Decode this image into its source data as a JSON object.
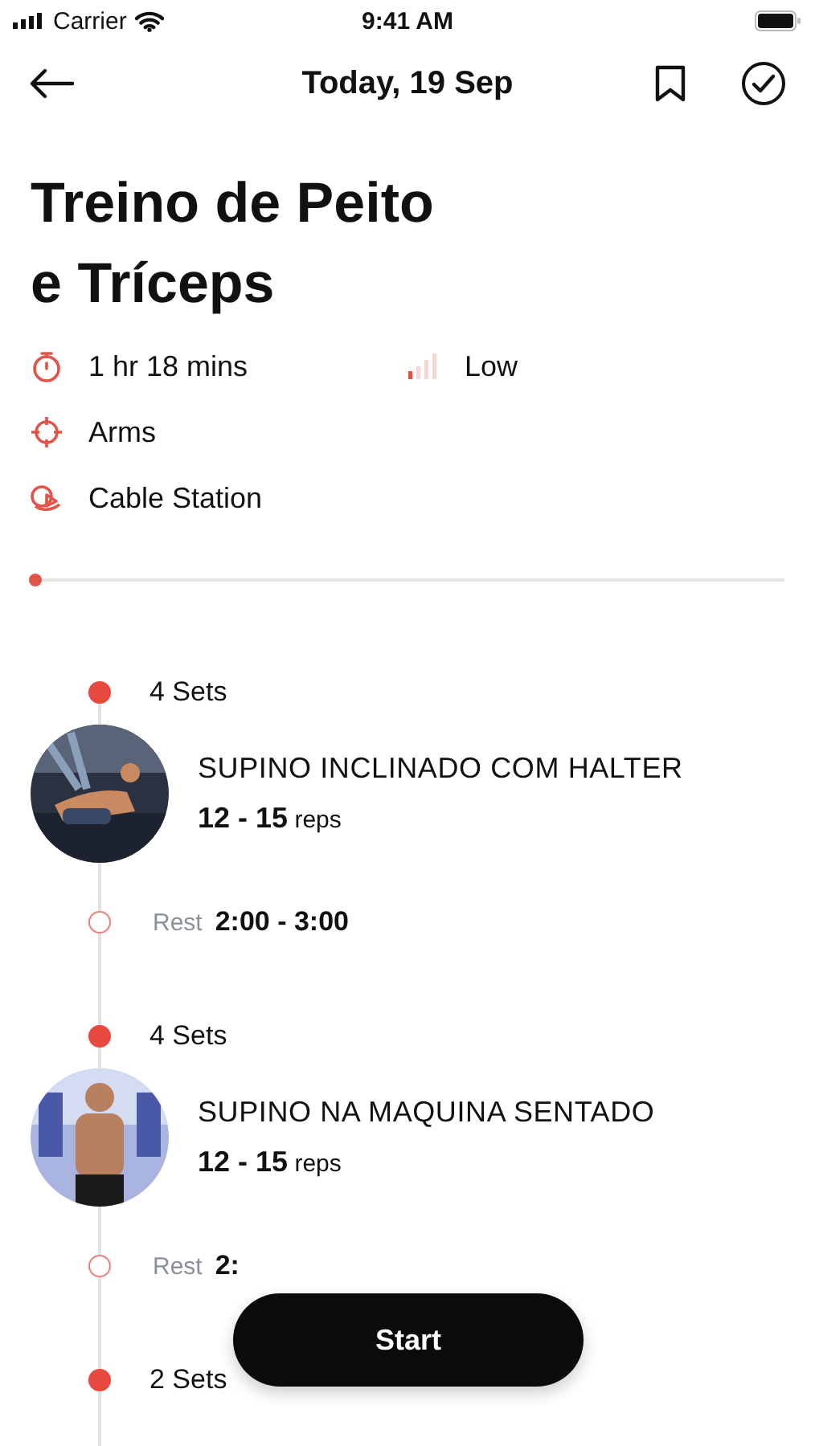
{
  "status_bar": {
    "carrier": "Carrier",
    "time": "9:41 AM"
  },
  "header": {
    "title": "Today, 19 Sep"
  },
  "workout": {
    "title": "Treino de Peito e Tríceps",
    "meta": [
      {
        "kind": "duration",
        "text": "1 hr 18 mins"
      },
      {
        "kind": "intensity",
        "text": "Low"
      },
      {
        "kind": "target",
        "text": "Arms"
      },
      {
        "kind": "equipment",
        "text": "Cable Station"
      }
    ],
    "progress": {
      "level": 0
    }
  },
  "timeline": [
    {
      "kind": "sets",
      "text": "4 Sets"
    },
    {
      "kind": "exercise",
      "name": "SUPINO INCLINADO COM HALTER",
      "reps": "**12 - 15** reps"
    },
    {
      "kind": "rest",
      "label": "Rest",
      "value": "2:00 - 3:00"
    },
    {
      "kind": "sets",
      "text": "4 Sets"
    },
    {
      "kind": "exercise",
      "name": "SUPINO NA MAQUINA SENTADO",
      "reps": "**12 - 15** reps"
    },
    {
      "kind": "rest",
      "label": "Rest",
      "value": "2:"
    },
    {
      "kind": "sets",
      "text": "2 Sets"
    }
  ],
  "start_button": {
    "label": "Start"
  }
}
